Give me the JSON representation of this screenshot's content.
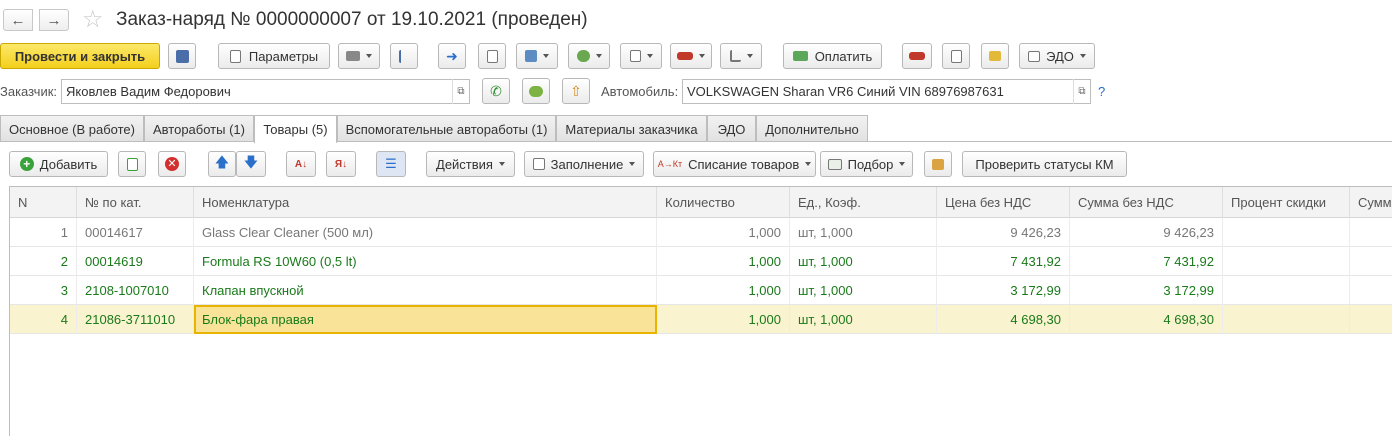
{
  "title": {
    "text": "Заказ-наряд № 0000000007  от 19.10.2021 (проведен)",
    "back_icon": "arrow-left-icon",
    "forward_icon": "arrow-right-icon",
    "favorite_icon": "star-icon"
  },
  "toolbar": {
    "post_and_close": "Провести и закрыть",
    "parameters": "Параметры",
    "pay": "Оплатить",
    "edo": "ЭДО"
  },
  "fields": {
    "customer_label": "Заказчик:",
    "customer_value": "Яковлев Вадим Федорович",
    "car_label": "Автомобиль:",
    "car_value": "VOLKSWAGEN Sharan VR6 Синий VIN 68976987631",
    "help": "?"
  },
  "tabs": [
    {
      "label": "Основное (В работе)"
    },
    {
      "label": "Автоработы (1)"
    },
    {
      "label": "Товары (5)"
    },
    {
      "label": "Вспомогательные автоработы (1)"
    },
    {
      "label": "Материалы заказчика"
    },
    {
      "label": "ЭДО"
    },
    {
      "label": "Дополнительно"
    }
  ],
  "active_tab": "Товары (5)",
  "table_toolbar": {
    "add": "Добавить",
    "actions": "Действия",
    "fill": "Заполнение",
    "writeoff": "Списание товаров",
    "selection": "Подбор",
    "check_km": "Проверить статусы КМ"
  },
  "table": {
    "columns": [
      "N",
      "№ по кат.",
      "Номенклатура",
      "Количество",
      "Ед., Коэф.",
      "Цена без НДС",
      "Сумма без НДС",
      "Процент скидки",
      "Сумм"
    ],
    "rows": [
      {
        "n": "1",
        "cat": "00014617",
        "name": "Glass Clear Cleaner (500 мл)",
        "qty": "1,000",
        "unit": "шт, 1,000",
        "price": "9 426,23",
        "sum": "9 426,23",
        "discount": "",
        "style": "gray"
      },
      {
        "n": "2",
        "cat": "00014619",
        "name": "Formula RS 10W60 (0,5 lt)",
        "qty": "1,000",
        "unit": "шт, 1,000",
        "price": "7 431,92",
        "sum": "7 431,92",
        "discount": "",
        "style": "green"
      },
      {
        "n": "3",
        "cat": "2108-1007010",
        "name": "Клапан впускной",
        "qty": "1,000",
        "unit": "шт, 1,000",
        "price": "3 172,99",
        "sum": "3 172,99",
        "discount": "",
        "style": "green"
      },
      {
        "n": "4",
        "cat": "21086-3711010",
        "name": "Блок-фара правая",
        "qty": "1,000",
        "unit": "шт, 1,000",
        "price": "4 698,30",
        "sum": "4 698,30",
        "discount": "",
        "style": "green"
      }
    ]
  },
  "colors": {
    "primary_button": "#f5d324",
    "selected_row": "#faf3cf",
    "green_text": "#1a7a1a",
    "gray_text": "#777777"
  }
}
